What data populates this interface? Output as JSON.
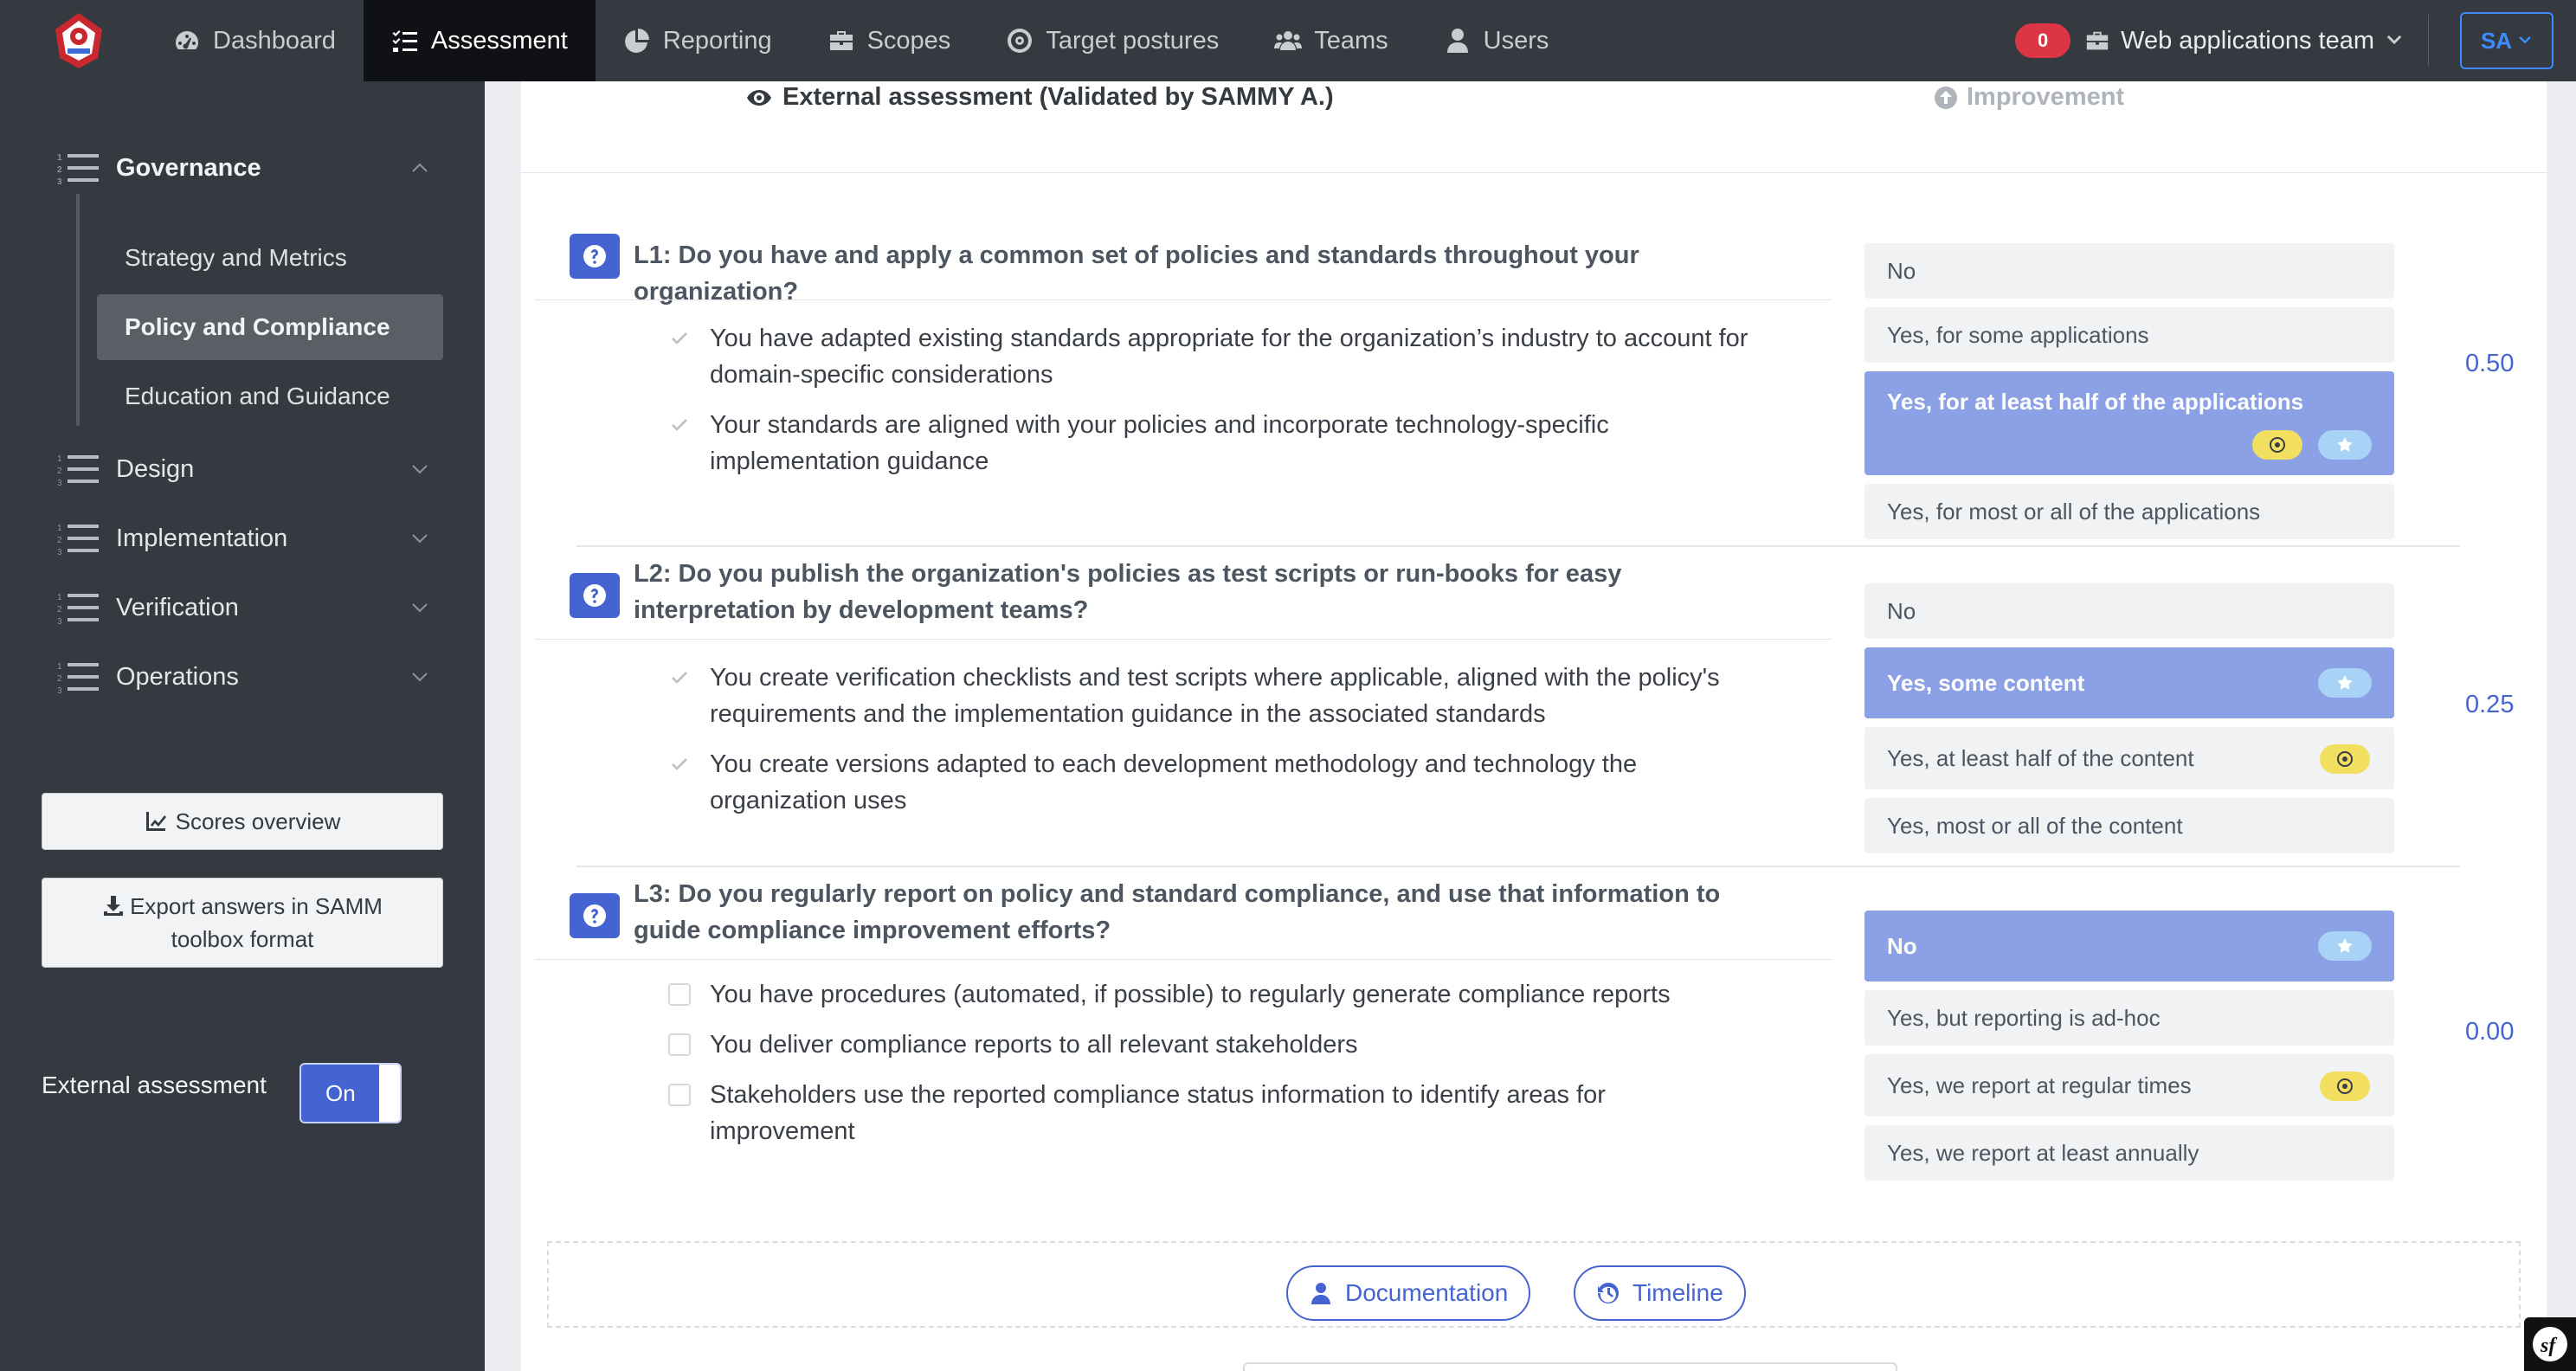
{
  "nav": {
    "items": [
      {
        "label": "Dashboard",
        "icon": "gauge-icon"
      },
      {
        "label": "Assessment",
        "icon": "list-check-icon",
        "active": true
      },
      {
        "label": "Reporting",
        "icon": "pie-chart-icon"
      },
      {
        "label": "Scopes",
        "icon": "briefcase-icon"
      },
      {
        "label": "Target postures",
        "icon": "target-icon"
      },
      {
        "label": "Teams",
        "icon": "users-icon"
      },
      {
        "label": "Users",
        "icon": "user-icon"
      }
    ],
    "notification_count": "0",
    "team": "Web applications team",
    "user_initials": "SA",
    "accent": "#3d8bfd"
  },
  "sidebar": {
    "sections": [
      {
        "label": "Governance",
        "open": true
      },
      {
        "label": "Design"
      },
      {
        "label": "Implementation"
      },
      {
        "label": "Verification"
      },
      {
        "label": "Operations"
      }
    ],
    "practices": [
      {
        "label": "Strategy and Metrics"
      },
      {
        "label": "Policy and Compliance",
        "active": true
      },
      {
        "label": "Education and Guidance"
      }
    ],
    "scores_button": "Scores overview",
    "export_button": "Export answers in SAMM toolbox format",
    "external_label": "External assessment",
    "toggle_label": "On"
  },
  "header": {
    "external_title": "External assessment (Validated by SAMMY A.)",
    "improvement_label": "Improvement"
  },
  "questions": [
    {
      "text": "L1: Do you have and apply a common set of policies and standards throughout your organization?",
      "criteria": [
        {
          "text": "You have adapted existing standards appropriate for the organization’s industry to account for domain-specific considerations",
          "checked": true
        },
        {
          "text": "Your standards are aligned with your policies and incorporate technology-specific implementation guidance",
          "checked": true
        }
      ],
      "answers": [
        {
          "label": "No"
        },
        {
          "label": "Yes, for some applications"
        },
        {
          "label": "Yes, for at least half of the applications",
          "selected": true,
          "target": true,
          "star": true
        },
        {
          "label": "Yes, for most or all of the applications"
        }
      ],
      "score": "0.50"
    },
    {
      "text": "L2: Do you publish the organization's policies as test scripts or run-books for easy interpretation by development teams?",
      "criteria": [
        {
          "text": "You create verification checklists and test scripts where applicable, aligned with the policy's requirements and the implementation guidance in the associated standards",
          "checked": true
        },
        {
          "text": "You create versions adapted to each development methodology and technology the organization uses",
          "checked": true
        }
      ],
      "answers": [
        {
          "label": "No"
        },
        {
          "label": "Yes, some content",
          "selected": true,
          "star": true
        },
        {
          "label": "Yes, at least half of the content",
          "target": true
        },
        {
          "label": "Yes, most or all of the content"
        }
      ],
      "score": "0.25"
    },
    {
      "text": "L3: Do you regularly report on policy and standard compliance, and use that information to guide compliance improvement efforts?",
      "criteria": [
        {
          "text": "You have procedures (automated, if possible) to regularly generate compliance reports",
          "checked": false
        },
        {
          "text": "You deliver compliance reports to all relevant stakeholders",
          "checked": false
        },
        {
          "text": "Stakeholders use the reported compliance status information to identify areas for improvement",
          "checked": false
        }
      ],
      "answers": [
        {
          "label": "No",
          "selected": true,
          "star": true
        },
        {
          "label": "Yes, but reporting is ad-hoc"
        },
        {
          "label": "Yes, we report at regular times",
          "target": true
        },
        {
          "label": "Yes, we report at least annually"
        }
      ],
      "score": "0.00"
    }
  ],
  "footer": {
    "documentation_button": "Documentation",
    "timeline_button": "Timeline"
  },
  "colors": {
    "primary": "#4664d1",
    "selected_answer": "#8ba0e5",
    "target_pill": "#f2df5f",
    "star_pill": "#a8d3f6",
    "nav_bg": "#343a40"
  }
}
